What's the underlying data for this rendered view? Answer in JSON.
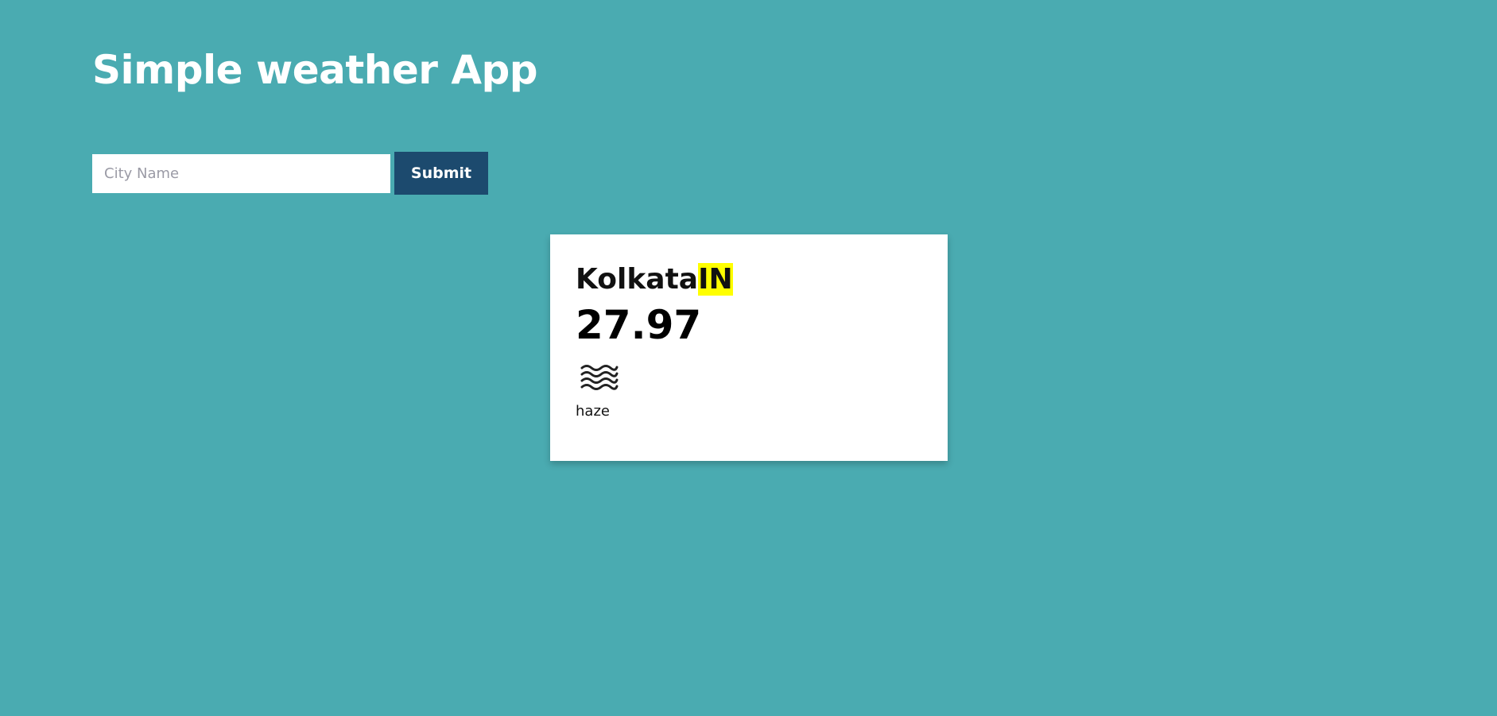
{
  "header": {
    "title": "Simple weather App"
  },
  "search": {
    "placeholder": "City Name",
    "value": "",
    "submit_label": "Submit"
  },
  "weather": {
    "city": "Kolkata",
    "country": "IN",
    "temperature": "27.97",
    "icon": "haze-icon",
    "description": "haze"
  },
  "colors": {
    "background": "#4aabb1",
    "submit_button": "#1c4a6e",
    "country_highlight": "#ffff00"
  }
}
